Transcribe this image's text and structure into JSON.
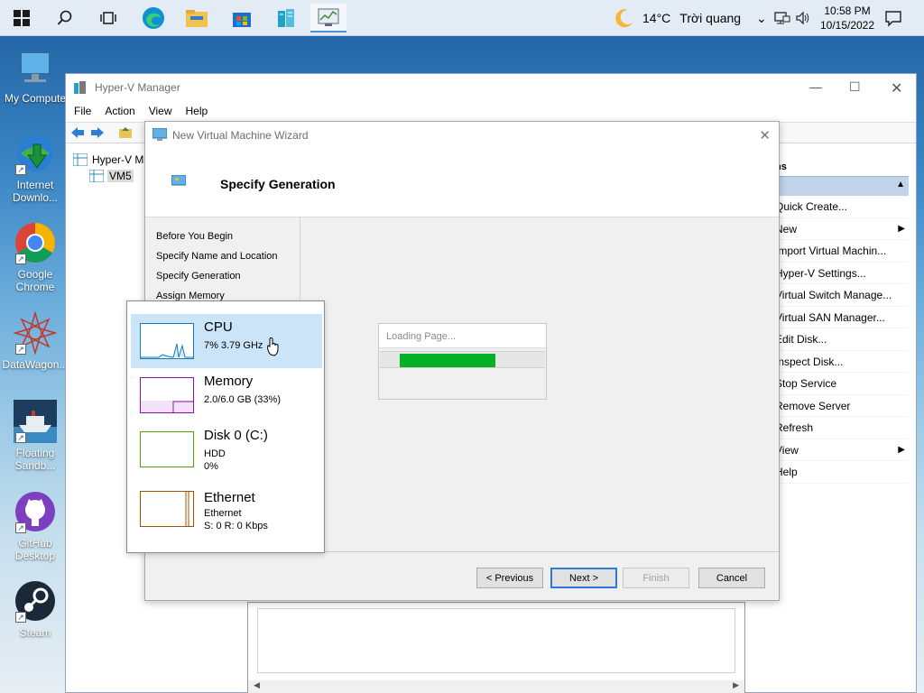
{
  "taskbar": {
    "icons": [
      "windows-start",
      "search",
      "task-view",
      "edge",
      "file-explorer",
      "store",
      "hyper-v-manager",
      "task-manager"
    ],
    "weather": {
      "temp": "14°C",
      "desc": "Trời quang"
    },
    "clock": {
      "time": "10:58 PM",
      "date": "10/15/2022"
    }
  },
  "desktop": {
    "icons": [
      {
        "label": "My Compute"
      },
      {
        "label": "Internet Downlo..."
      },
      {
        "label": "Google Chrome"
      },
      {
        "label": "DataWagon..."
      },
      {
        "label": "Floating Sandb..."
      },
      {
        "label": "GitHub Desktop"
      },
      {
        "label": "Steam"
      }
    ]
  },
  "hyperv": {
    "title": "Hyper-V Manager",
    "menu": [
      "File",
      "Action",
      "View",
      "Help"
    ],
    "tree": {
      "root": "Hyper-V M",
      "child": "VM5"
    },
    "actions": {
      "header": "ns",
      "items": [
        "Quick Create...",
        "New",
        "Import Virtual Machin...",
        "Hyper-V Settings...",
        "Virtual Switch Manage...",
        "Virtual SAN Manager...",
        "Edit Disk...",
        "Inspect Disk...",
        "Stop Service",
        "Remove Server",
        "Refresh",
        "View",
        "Help"
      ]
    }
  },
  "wizard": {
    "title": "New Virtual Machine Wizard",
    "heading": "Specify Generation",
    "steps": [
      "Before You Begin",
      "Specify Name and Location",
      "Specify Generation",
      "Assign Memory"
    ],
    "loading_text": "Loading Page...",
    "loading_progress": 0.7,
    "buttons": {
      "previous": "< Previous",
      "next": "Next >",
      "finish": "Finish",
      "cancel": "Cancel"
    }
  },
  "taskmgr": {
    "items": [
      {
        "name": "CPU",
        "line1": "7% 3.79 GHz",
        "line2": ""
      },
      {
        "name": "Memory",
        "line1": "2.0/6.0 GB (33%)",
        "line2": ""
      },
      {
        "name": "Disk 0 (C:)",
        "line1": "HDD",
        "line2": "0%"
      },
      {
        "name": "Ethernet",
        "line1": "Ethernet",
        "line2": "S: 0 R: 0 Kbps"
      }
    ],
    "colors": {
      "cpu": "#117dbb",
      "memory": "#8b12ae",
      "disk": "#4da60c",
      "ethernet": "#a74f01"
    }
  }
}
